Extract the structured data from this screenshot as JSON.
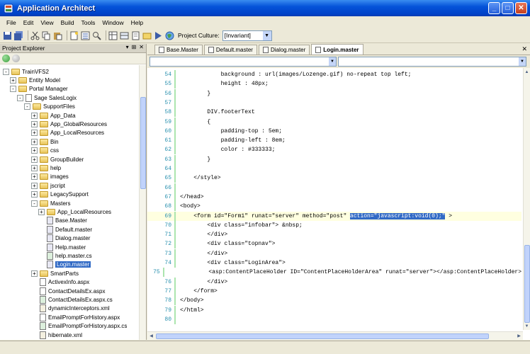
{
  "window": {
    "title": "Application Architect"
  },
  "menu": [
    "File",
    "Edit",
    "View",
    "Build",
    "Tools",
    "Window",
    "Help"
  ],
  "toolbar": {
    "culture_label": "Project Culture:",
    "culture_value": "[Invariant]"
  },
  "explorer": {
    "title": "Project Explorer",
    "controls": [
      "▾",
      "⊞",
      "✕"
    ],
    "tree": [
      {
        "depth": 0,
        "type": "folder",
        "label": "TrainVFS2",
        "exp": "-"
      },
      {
        "depth": 1,
        "type": "folder",
        "label": "Entity Model",
        "exp": "+"
      },
      {
        "depth": 1,
        "type": "folder",
        "label": "Portal Manager",
        "exp": "-"
      },
      {
        "depth": 2,
        "type": "file",
        "label": "Sage SalesLogix",
        "exp": "-"
      },
      {
        "depth": 3,
        "type": "folder",
        "label": "SupportFiles",
        "exp": "-"
      },
      {
        "depth": 4,
        "type": "folder",
        "label": "App_Data",
        "exp": "+"
      },
      {
        "depth": 4,
        "type": "folder",
        "label": "App_GlobalResources",
        "exp": "+"
      },
      {
        "depth": 4,
        "type": "folder",
        "label": "App_LocalResources",
        "exp": "+"
      },
      {
        "depth": 4,
        "type": "folder",
        "label": "Bin",
        "exp": "+"
      },
      {
        "depth": 4,
        "type": "folder",
        "label": "css",
        "exp": "+"
      },
      {
        "depth": 4,
        "type": "folder",
        "label": "GroupBuilder",
        "exp": "+"
      },
      {
        "depth": 4,
        "type": "folder",
        "label": "help",
        "exp": "+"
      },
      {
        "depth": 4,
        "type": "folder",
        "label": "images",
        "exp": "+"
      },
      {
        "depth": 4,
        "type": "folder",
        "label": "jscript",
        "exp": "+"
      },
      {
        "depth": 4,
        "type": "folder",
        "label": "LegacySupport",
        "exp": "+"
      },
      {
        "depth": 4,
        "type": "folder",
        "label": "Masters",
        "exp": "-"
      },
      {
        "depth": 5,
        "type": "folder",
        "label": "App_LocalResources",
        "exp": "+"
      },
      {
        "depth": 5,
        "type": "master",
        "label": "Base.Master",
        "exp": ""
      },
      {
        "depth": 5,
        "type": "master",
        "label": "Default.master",
        "exp": ""
      },
      {
        "depth": 5,
        "type": "master",
        "label": "Dialog.master",
        "exp": ""
      },
      {
        "depth": 5,
        "type": "master",
        "label": "Help.master",
        "exp": ""
      },
      {
        "depth": 5,
        "type": "cs",
        "label": "help.master.cs",
        "exp": ""
      },
      {
        "depth": 5,
        "type": "master",
        "label": "Login.master",
        "exp": "",
        "selected": true
      },
      {
        "depth": 4,
        "type": "folder",
        "label": "SmartParts",
        "exp": "+"
      },
      {
        "depth": 4,
        "type": "file",
        "label": "ActivexInfo.aspx",
        "exp": ""
      },
      {
        "depth": 4,
        "type": "file",
        "label": "ContactDetailsEx.aspx",
        "exp": ""
      },
      {
        "depth": 4,
        "type": "cs",
        "label": "ContactDetailsEx.aspx.cs",
        "exp": ""
      },
      {
        "depth": 4,
        "type": "xml",
        "label": "dynamicInterceptors.xml",
        "exp": ""
      },
      {
        "depth": 4,
        "type": "file",
        "label": "EmailPromptForHistory.aspx",
        "exp": ""
      },
      {
        "depth": 4,
        "type": "cs",
        "label": "EmailPromptForHistory.aspx.cs",
        "exp": ""
      },
      {
        "depth": 4,
        "type": "xml",
        "label": "hibernate.xml",
        "exp": ""
      }
    ]
  },
  "tabs": [
    {
      "label": "Base.Master",
      "active": false
    },
    {
      "label": "Default.master",
      "active": false
    },
    {
      "label": "Dialog.master",
      "active": false
    },
    {
      "label": "Login.master",
      "active": true
    }
  ],
  "code": [
    {
      "n": "54",
      "t": "            background : url(images/Lozenge.gif) no-repeat top left;"
    },
    {
      "n": "55",
      "t": "            height : 48px;"
    },
    {
      "n": "56",
      "t": "        }"
    },
    {
      "n": "57",
      "t": ""
    },
    {
      "n": "58",
      "t": "        DIV.footerText"
    },
    {
      "n": "59",
      "t": "        {"
    },
    {
      "n": "60",
      "t": "            padding-top : 5em;"
    },
    {
      "n": "61",
      "t": "            padding-left : 8em;"
    },
    {
      "n": "62",
      "t": "            color : #333333;"
    },
    {
      "n": "63",
      "t": "        }"
    },
    {
      "n": "64",
      "t": ""
    },
    {
      "n": "65",
      "t": "    </style>"
    },
    {
      "n": "66",
      "t": ""
    },
    {
      "n": "67",
      "t": "</head>"
    },
    {
      "n": "68",
      "t": "<body>"
    },
    {
      "n": "69",
      "t": "    <form id=\"Form1\" runat=\"server\" method=\"post\" ",
      "sel": "action=\"javascript:void(0);\"",
      "after": " >"
    },
    {
      "n": "70",
      "t": "        <div class=\"infobar\"> &nbsp;"
    },
    {
      "n": "71",
      "t": "        </div>"
    },
    {
      "n": "72",
      "t": "        <div class=\"topnav\">"
    },
    {
      "n": "73",
      "t": "        </div>"
    },
    {
      "n": "74",
      "t": "        <div class=\"LoginArea\">"
    },
    {
      "n": "75",
      "t": "            <asp:ContentPlaceHolder ID=\"ContentPlaceHolderArea\" runat=\"server\"></asp:ContentPlaceHolder>"
    },
    {
      "n": "76",
      "t": "        </div>"
    },
    {
      "n": "77",
      "t": "    </form>"
    },
    {
      "n": "78",
      "t": "</body>"
    },
    {
      "n": "79",
      "t": "</html>"
    },
    {
      "n": "80",
      "t": ""
    }
  ]
}
